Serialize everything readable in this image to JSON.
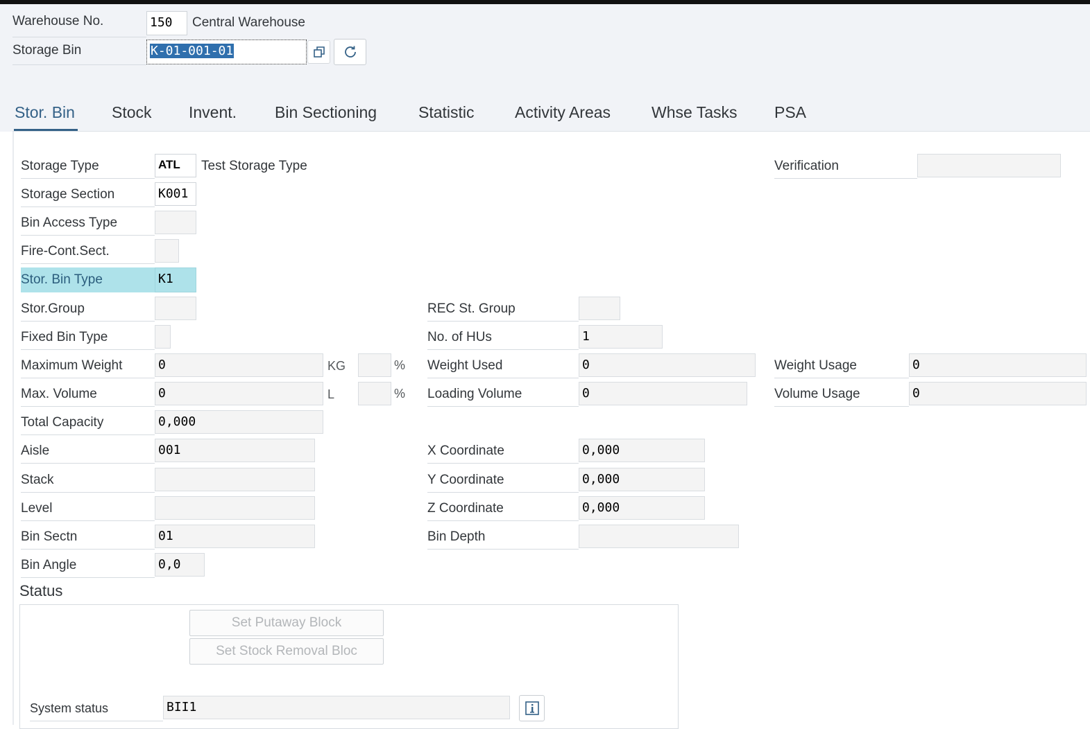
{
  "header": {
    "warehouse_label": "Warehouse No.",
    "warehouse_value": "150",
    "warehouse_desc": "Central Warehouse",
    "bin_label": "Storage Bin",
    "bin_value": "K-01-001-01"
  },
  "tabs": [
    "Stor. Bin",
    "Stock",
    "Invent.",
    "Bin Sectioning",
    "Statistic",
    "Activity Areas",
    "Whse Tasks",
    "PSA"
  ],
  "active_tab": "Stor. Bin",
  "left": {
    "storage_type": {
      "label": "Storage Type",
      "value": "ATL",
      "desc": "Test Storage Type"
    },
    "storage_section": {
      "label": "Storage Section",
      "value": "K001"
    },
    "bin_access_type": {
      "label": "Bin Access Type",
      "value": ""
    },
    "fire_cont_sect": {
      "label": "Fire-Cont.Sect.",
      "value": ""
    },
    "stor_bin_type": {
      "label": "Stor. Bin Type",
      "value": "K1"
    },
    "stor_group": {
      "label": "Stor.Group",
      "value": ""
    },
    "fixed_bin_type": {
      "label": "Fixed Bin Type",
      "value": ""
    },
    "max_weight": {
      "label": "Maximum Weight",
      "value": "0",
      "unit": "KG",
      "pct": ""
    },
    "max_volume": {
      "label": "Max. Volume",
      "value": "0",
      "unit": "L",
      "pct": ""
    },
    "total_capacity": {
      "label": "Total Capacity",
      "value": "0,000"
    },
    "aisle": {
      "label": "Aisle",
      "value": "001"
    },
    "stack": {
      "label": "Stack",
      "value": ""
    },
    "level": {
      "label": "Level",
      "value": ""
    },
    "bin_sectn": {
      "label": "Bin Sectn",
      "value": "01"
    },
    "bin_angle": {
      "label": "Bin Angle",
      "value": "0,0"
    }
  },
  "percent_sign": "%",
  "middle": {
    "rec_st_group": {
      "label": "REC St. Group",
      "value": ""
    },
    "no_of_hus": {
      "label": "No. of HUs",
      "value": "1"
    },
    "weight_used": {
      "label": "Weight Used",
      "value": "0"
    },
    "loading_volume": {
      "label": "Loading Volume",
      "value": "0"
    },
    "x_coord": {
      "label": "X Coordinate",
      "value": "0,000"
    },
    "y_coord": {
      "label": "Y Coordinate",
      "value": "0,000"
    },
    "z_coord": {
      "label": "Z Coordinate",
      "value": "0,000"
    },
    "bin_depth": {
      "label": "Bin Depth",
      "value": ""
    }
  },
  "right": {
    "verification": {
      "label": "Verification",
      "value": ""
    },
    "weight_usage": {
      "label": "Weight Usage",
      "value": "0"
    },
    "volume_usage": {
      "label": "Volume Usage",
      "value": "0"
    }
  },
  "status": {
    "title": "Status",
    "putaway_button": "Set Putaway Block",
    "removal_button": "Set Stock Removal Bloc",
    "system_status_label": "System status",
    "system_status_value": "BII1"
  },
  "icons": {
    "copy": "copy-icon",
    "refresh": "refresh-icon",
    "info": "info-icon"
  },
  "colors": {
    "highlight": "#aee2ea",
    "active_tab": "#346187",
    "selection": "#2f6fad"
  }
}
